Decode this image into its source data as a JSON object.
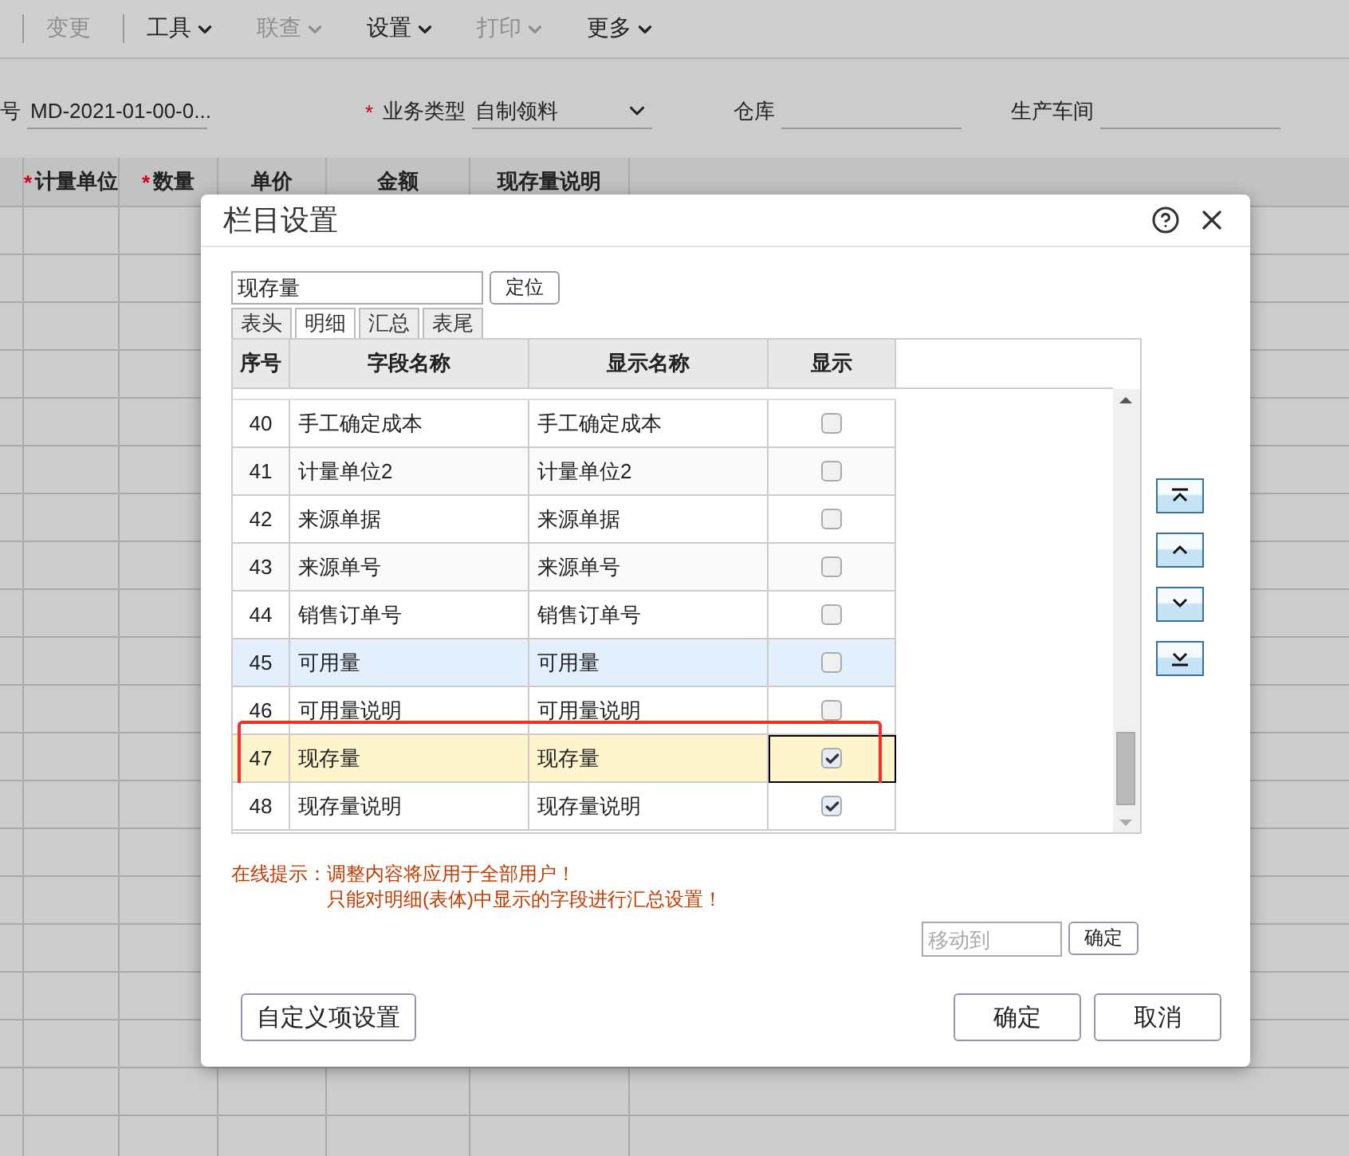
{
  "toolbar": [
    {
      "label": "变更",
      "disabled": true,
      "has_menu": false,
      "divider_before": true
    },
    {
      "label": "工具",
      "disabled": false,
      "has_menu": true,
      "divider_before": true
    },
    {
      "label": "联查",
      "disabled": true,
      "has_menu": true,
      "divider_before": false
    },
    {
      "label": "设置",
      "disabled": false,
      "has_menu": true,
      "divider_before": false
    },
    {
      "label": "打印",
      "disabled": true,
      "has_menu": true,
      "divider_before": false
    },
    {
      "label": "更多",
      "disabled": false,
      "has_menu": true,
      "divider_before": false
    }
  ],
  "form_fields": [
    {
      "label": "号",
      "required": false,
      "kind": "text",
      "value": "MD-2021-01-00-0..."
    },
    {
      "label": "业务类型",
      "required": true,
      "required_mark": "*",
      "kind": "select",
      "value": "自制领料"
    },
    {
      "label": "仓库",
      "required": false,
      "kind": "text"
    },
    {
      "label": "生产车间",
      "required": false,
      "kind": "text"
    }
  ],
  "table": {
    "columns": [
      {
        "label": "计量单位",
        "required": true,
        "required_mark": "*"
      },
      {
        "label": "数量",
        "required": true,
        "required_mark": "*"
      },
      {
        "label": "单价",
        "required": false
      },
      {
        "label": "金额",
        "required": false
      },
      {
        "label": "现存量说明",
        "required": false
      }
    ]
  },
  "dialog": {
    "title": "栏目设置",
    "search": {
      "value": "现存量"
    },
    "locate_button": "定位",
    "tabs": [
      {
        "label": "表头",
        "selected": false
      },
      {
        "label": "明细",
        "selected": true
      },
      {
        "label": "汇总",
        "selected": false
      },
      {
        "label": "表尾",
        "selected": false
      }
    ],
    "columns": [
      "序号",
      "字段名称",
      "显示名称",
      "显示"
    ],
    "rows": [
      {
        "index": "40",
        "field": "手工确定成本",
        "display": "手工确定成本",
        "shown": false,
        "selected": false,
        "hovered": false,
        "outlined": false
      },
      {
        "index": "41",
        "field": "计量单位2",
        "display": "计量单位2",
        "shown": false,
        "selected": false,
        "hovered": false,
        "outlined": false
      },
      {
        "index": "42",
        "field": "来源单据",
        "display": "来源单据",
        "shown": false,
        "selected": false,
        "hovered": false,
        "outlined": false
      },
      {
        "index": "43",
        "field": "来源单号",
        "display": "来源单号",
        "shown": false,
        "selected": false,
        "hovered": false,
        "outlined": false
      },
      {
        "index": "44",
        "field": "销售订单号",
        "display": "销售订单号",
        "shown": false,
        "selected": false,
        "hovered": false,
        "outlined": false
      },
      {
        "index": "45",
        "field": "可用量",
        "display": "可用量",
        "shown": false,
        "selected": false,
        "hovered": true,
        "outlined": false
      },
      {
        "index": "46",
        "field": "可用量说明",
        "display": "可用量说明",
        "shown": false,
        "selected": false,
        "hovered": false,
        "outlined": false
      },
      {
        "index": "47",
        "field": "现存量",
        "display": "现存量",
        "shown": true,
        "selected": true,
        "hovered": false,
        "outlined": true
      },
      {
        "index": "48",
        "field": "现存量说明",
        "display": "现存量说明",
        "shown": true,
        "selected": false,
        "hovered": false,
        "outlined": false
      }
    ],
    "notice_label": "在线提示：",
    "notices": [
      "调整内容将应用于全部用户！",
      "只能对明细(表体)中显示的字段进行汇总设置！"
    ],
    "move_to": {
      "placeholder": "移动到",
      "button": "确定"
    },
    "custom_button": "自定义项设置",
    "ok_button": "确定",
    "cancel_button": "取消"
  }
}
